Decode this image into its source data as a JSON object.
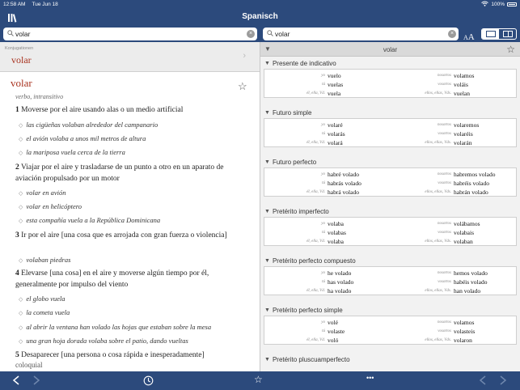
{
  "status": {
    "time": "12:58 AM",
    "date": "Tue Jun 18",
    "battery": "100%"
  },
  "nav": {
    "title": "Spanisch"
  },
  "search_left": {
    "value": "volar"
  },
  "search_right": {
    "value": "volar"
  },
  "text_size_label": {
    "small": "A",
    "big": "A"
  },
  "left": {
    "konj_caption": "Konjugationen",
    "konj_word": "volar",
    "headword": "volar",
    "pos": "verbo, intransitivo",
    "senses": [
      {
        "num": "1",
        "text": "Moverse por el aire usando alas o un medio artificial",
        "examples": [
          "las cigüeñas volaban alrededor del campanario",
          "el avión volaba a unos mil metros de altura",
          "la mariposa vuela cerca de la tierra"
        ]
      },
      {
        "num": "2",
        "text": "Viajar por el aire y trasladarse de un punto a otro en un aparato de aviación propulsado por un motor",
        "examples": [
          "volar en avión",
          "volar en helicóptero",
          "esta compañía vuela a la República Dominicana"
        ]
      },
      {
        "num": "3",
        "text": "Ir por el aire [una cosa que es arrojada con gran fuerza o violencia]",
        "examples": [
          "volaban piedras"
        ]
      },
      {
        "num": "4",
        "text": "Elevarse [una cosa] en el aire y moverse algún tiempo por él, generalmente por impulso del viento",
        "examples": [
          "el globo vuela",
          "la cometa vuela",
          "al abrir la ventana han volado las hojas que estaban sobre la mesa",
          "una gran hoja dorada volaba sobre el patio, dando vueltas"
        ]
      },
      {
        "num": "5",
        "text": "Desaparecer [una persona o cosa rápida e inesperadamente]"
      }
    ],
    "cut_text": "coloquial"
  },
  "right": {
    "verb": "volar",
    "tenses": [
      {
        "name": "Presente de indicativo",
        "forms": [
          [
            "yo",
            "vuelo",
            "nosotros",
            "volamos"
          ],
          [
            "tú",
            "vuelas",
            "vosotros",
            "voláis"
          ],
          [
            "él, ella, Vd.",
            "vuela",
            "ellos, ellas, Vds.",
            "vuelan"
          ]
        ]
      },
      {
        "name": "Futuro simple",
        "forms": [
          [
            "yo",
            "volaré",
            "nosotros",
            "volaremos"
          ],
          [
            "tú",
            "volarás",
            "vosotros",
            "volaréis"
          ],
          [
            "él, ella, Vd.",
            "volará",
            "ellos, ellas, Vds.",
            "volarán"
          ]
        ]
      },
      {
        "name": "Futuro perfecto",
        "forms": [
          [
            "yo",
            "habré volado",
            "nosotros",
            "habremos volado"
          ],
          [
            "tú",
            "habrás volado",
            "vosotros",
            "habréis volado"
          ],
          [
            "él, ella, Vd.",
            "habrá volado",
            "ellos, ellas, Vds.",
            "habrán volado"
          ]
        ]
      },
      {
        "name": "Pretérito imperfecto",
        "forms": [
          [
            "yo",
            "volaba",
            "nosotros",
            "volábamos"
          ],
          [
            "tú",
            "volabas",
            "vosotros",
            "volabais"
          ],
          [
            "él, ella, Vd.",
            "volaba",
            "ellos, ellas, Vds.",
            "volaban"
          ]
        ]
      },
      {
        "name": "Pretérito perfecto compuesto",
        "forms": [
          [
            "yo",
            "he volado",
            "nosotros",
            "hemos volado"
          ],
          [
            "tú",
            "has volado",
            "vosotros",
            "habéis volado"
          ],
          [
            "él, ella, Vd.",
            "ha volado",
            "ellos, ellas, Vds.",
            "han volado"
          ]
        ]
      },
      {
        "name": "Pretérito perfecto simple",
        "forms": [
          [
            "yo",
            "volé",
            "nosotros",
            "volamos"
          ],
          [
            "tú",
            "volaste",
            "vosotros",
            "volasteis"
          ],
          [
            "él, ella, Vd.",
            "voló",
            "ellos, ellas, Vds.",
            "volaron"
          ]
        ]
      },
      {
        "name": "Pretérito pluscuamperfecto"
      }
    ]
  },
  "toolbar": {
    "more": "•••"
  }
}
